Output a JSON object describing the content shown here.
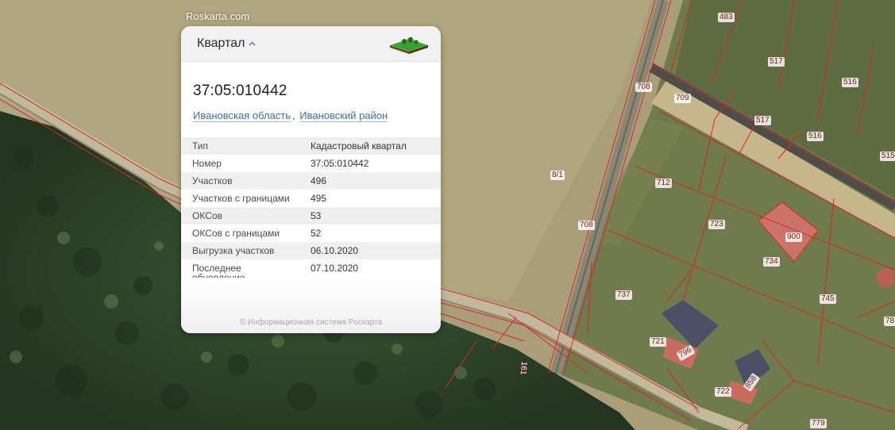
{
  "site": {
    "label": "Roskarta.com"
  },
  "card": {
    "title": "Квартал",
    "logo_icon": "terrain-icon",
    "cadastral_number": "37:05:010442",
    "region_link": "Ивановская область",
    "separator": ",",
    "district_link": "Ивановский район",
    "rows": [
      {
        "key": "Тип",
        "value": "Кадастровый квартал"
      },
      {
        "key": "Номер",
        "value": "37:05:010442"
      },
      {
        "key": "Участков",
        "value": "496"
      },
      {
        "key": "Участков с границами",
        "value": "495"
      },
      {
        "key": "ОКСов",
        "value": "53"
      },
      {
        "key": "ОКСов с границами",
        "value": "52"
      },
      {
        "key": "Выгрузка участков",
        "value": "06.10.2020"
      },
      {
        "key": "Последнее обновление",
        "value": "07.10.2020"
      }
    ],
    "footer": "© Информационная система Роскарта"
  },
  "map": {
    "parcel_labels": [
      "483",
      "517",
      "516",
      "708",
      "709",
      "517",
      "516",
      "515",
      "8/1",
      "712",
      "723",
      "900",
      "708",
      "734",
      "745",
      "737",
      "78",
      "721",
      "796",
      "161",
      "722",
      "858",
      "779"
    ],
    "colors": {
      "parcel_border": "#d9262a",
      "field": "#a99e76",
      "forest": "#2f4a2b",
      "grass": "#6e7a4c"
    }
  }
}
